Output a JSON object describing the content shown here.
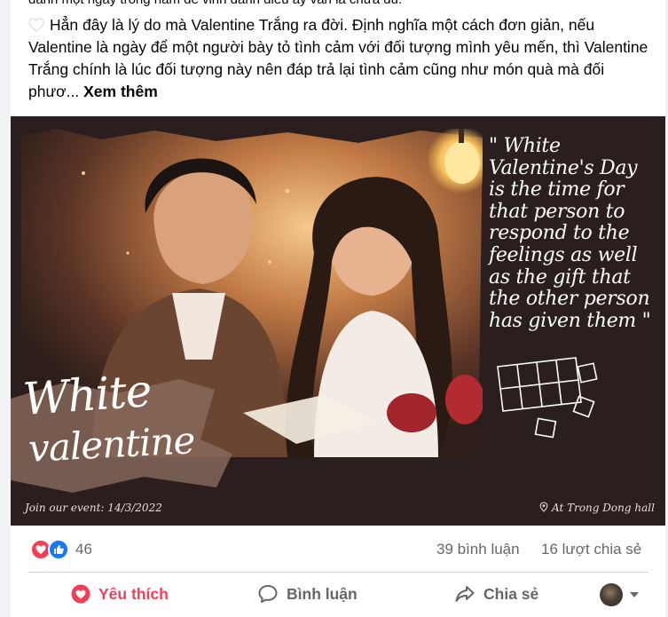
{
  "post": {
    "cut_line": "danh một ngày trong năm để vinh danh điều ấy vẫn là chưa đủ.",
    "text": "Hẳn đây là lý do mà Valentine Trắng ra đời. Định nghĩa một cách đơn giản, nếu Valentine là ngày để một người bày tỏ tình cảm với đối tượng mình yêu mến, thì Valentine Trắng chính là lúc đối tượng này nên đáp trả lại tình cảm cũng như món quà mà đối phươ...",
    "see_more": "Xem thêm"
  },
  "poster": {
    "quote_lines": [
      "\" White",
      "Valentine's Day",
      "is the time for",
      "that person to",
      "respond to the",
      "feelings as well",
      "as the gift that",
      "the other person",
      "has given them \""
    ],
    "title_line1": "White",
    "title_line2": "valentine",
    "event_text": "Join our event: 14/3/2022",
    "place_text": "At Trong Dong hall"
  },
  "stats": {
    "reaction_count": "46",
    "comments": "39 bình luận",
    "shares": "16 lượt chia sẻ"
  },
  "actions": {
    "like": "Yêu thích",
    "comment": "Bình luận",
    "share": "Chia sẻ"
  },
  "colors": {
    "love_red": "#f33e58",
    "like_blue": "#1877f2",
    "poster_bg": "#2a1f1e"
  }
}
